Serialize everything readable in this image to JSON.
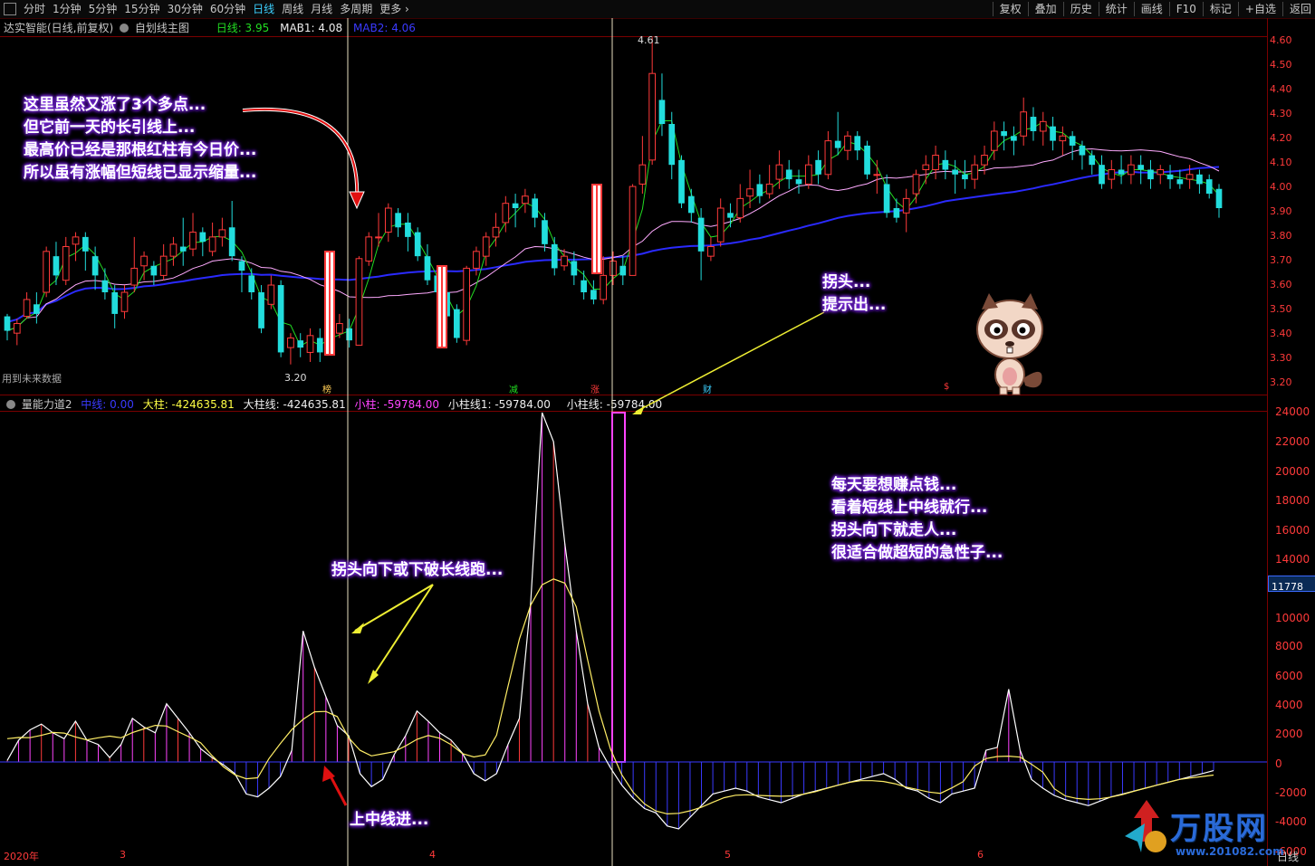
{
  "toolbar": {
    "periods": [
      "分时",
      "1分钟",
      "5分钟",
      "15分钟",
      "30分钟",
      "60分钟",
      "日线",
      "周线",
      "月线",
      "多周期",
      "更多"
    ],
    "active": "日线",
    "right": [
      "复权",
      "叠加",
      "历史",
      "统计",
      "画线",
      "F10",
      "标记",
      "+自选",
      "返回"
    ]
  },
  "header": {
    "stock": "达实智能(日线,前复权)",
    "template": "自划线主图",
    "day_label": "日线: 3.95",
    "mab1_label": "MAB1: 4.08",
    "mab2_label": "MAB2: 4.06"
  },
  "sub_header": {
    "name": "量能力道2",
    "zhongxian": "中线: 0.00",
    "dazhu": "大柱: -424635.81",
    "dazhuxian": "大柱线: -424635.81",
    "xiaozhu": "小柱: -59784.00",
    "xiaozhuxian1": "小柱线1: -59784.00",
    "xiaozhuxian": "小柱线: -59784.00"
  },
  "future_note": "用到未来数据",
  "price_marks": {
    "high": "4.61",
    "low": "3.20"
  },
  "markers": [
    "榜",
    "减",
    "涨",
    "财",
    "$"
  ],
  "price_axis": [
    "4.60",
    "4.50",
    "4.40",
    "4.30",
    "4.20",
    "4.10",
    "4.00",
    "3.90",
    "3.80",
    "3.70",
    "3.60",
    "3.50",
    "3.40",
    "3.30",
    "3.20"
  ],
  "vol_axis": [
    "24000",
    "22000",
    "20000",
    "18000",
    "16000",
    "14000",
    "10000",
    "8000",
    "6000",
    "4000",
    "2000",
    "0",
    "-2000",
    "-4000",
    "-6000"
  ],
  "vol_current": "11778",
  "dates": [
    "2020年",
    "3",
    "4",
    "5",
    "6"
  ],
  "period_label": "日线",
  "annotations": {
    "top_left": [
      "这里虽然又涨了3个多点...",
      "但它前一天的长引线上...",
      "最高价已经是那根红柱有今日价...",
      "所以虽有涨幅但短线已显示缩量..."
    ],
    "turn": [
      "拐头...",
      "提示出..."
    ],
    "right_note": [
      "每天要想赚点钱...",
      "看着短线上中线就行...",
      "拐头向下就走人...",
      "很适合做超短的急性子..."
    ],
    "break_down": "拐头向下或下破长线跑...",
    "enter": "上中线进..."
  },
  "watermark": {
    "brand": "万股网",
    "url": "www.201082.com"
  },
  "colors": {
    "up": "#ff3a3a",
    "down": "#22dddd",
    "ma_short": "#22dd22",
    "ma_mid": "#ffaaff",
    "ma_long": "#2a2aff",
    "border": "#7a0000"
  }
}
